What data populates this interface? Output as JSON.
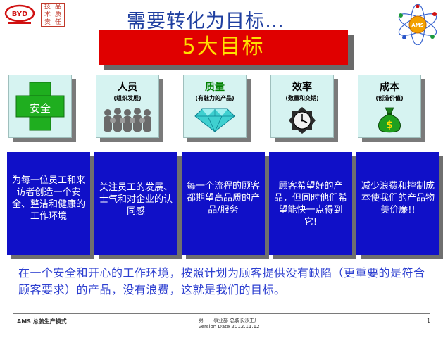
{
  "header": {
    "title": "需要转化为目标…",
    "seal_chars": [
      "技",
      "品",
      "术",
      "质",
      "责",
      "任"
    ],
    "byd_text": "BYD"
  },
  "banner": {
    "text": "5大目标"
  },
  "cards": [
    {
      "title": "安全",
      "subtitle": "",
      "icon": "green-cross-icon"
    },
    {
      "title": "人员",
      "subtitle": "(组织发展)",
      "icon": "people-group-icon"
    },
    {
      "title": "质量",
      "subtitle": "(有魅力的产品)",
      "icon": "diamond-icon"
    },
    {
      "title": "效率",
      "subtitle": "(数量和交期)",
      "icon": "clock-icon"
    },
    {
      "title": "成本",
      "subtitle": "(创造价值)",
      "icon": "money-bag-icon"
    }
  ],
  "descriptions": [
    "为每一位员工和来访者创造一个安全、整洁和健康的工作环境",
    "关注员工的发展、士气和对企业的认同感",
    "每一个流程的顾客都期望高品质的产品/服务",
    "顾客希望好的产品，但同时他们希望能快一点得到它!",
    "减少浪费和控制成本使我们的产品物美价廉!!"
  ],
  "summary": "在一个安全和开心的工作环境，按照计划为顾客提供没有缺陷（更重要的是符合顾客要求）的产品，没有浪费，这就是我们的目标。",
  "footer": {
    "left": "AMS 总装生产模式",
    "center_line1": "第十一事业部 总装长沙工厂",
    "center_line2": "Version Date 2012.11.12",
    "page": "1"
  },
  "colors": {
    "title_blue": "#1f3fa0",
    "banner_red": "#e00000",
    "banner_text": "#ffe000",
    "card_bg": "#d6f3f1",
    "desc_bg": "#1010c8",
    "summary_blue": "#2d3fd0"
  }
}
